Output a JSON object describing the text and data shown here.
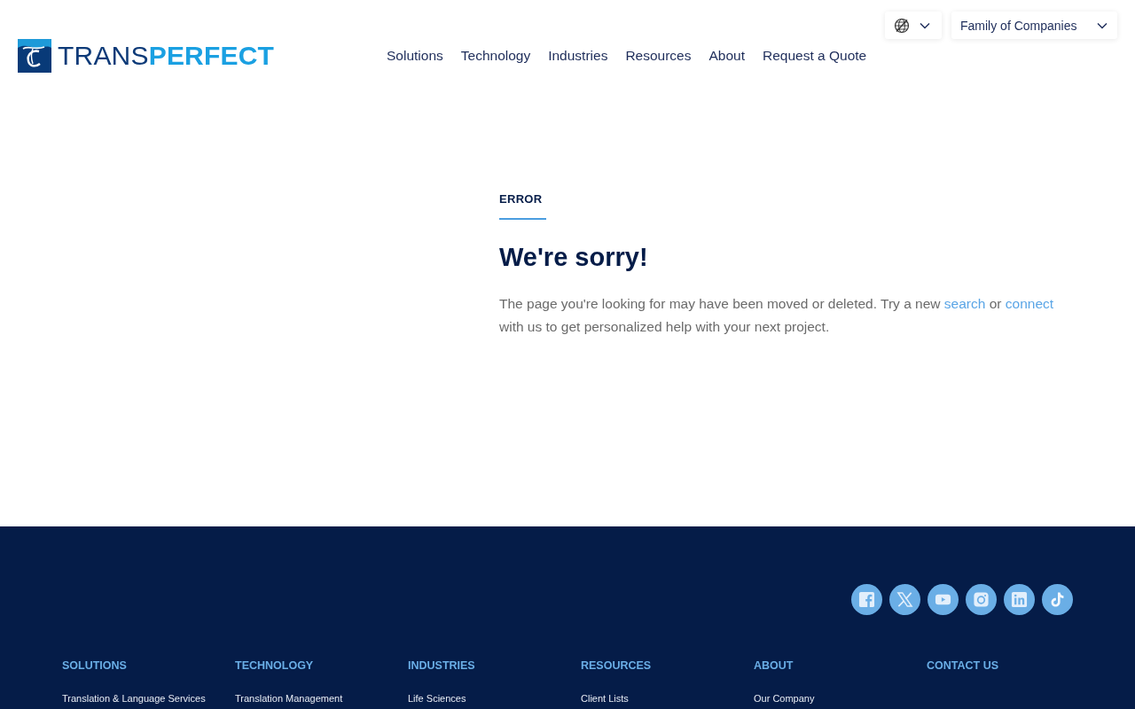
{
  "header": {
    "logo": {
      "parts": [
        {
          "text": "TRANS",
          "kind": "dark"
        },
        {
          "text": "PERFECT",
          "kind": "light"
        }
      ]
    },
    "company_selector": {
      "label": "Family of Companies"
    },
    "nav": [
      "Solutions",
      "Technology",
      "Industries",
      "Resources",
      "About",
      "Request a Quote"
    ]
  },
  "error": {
    "eyebrow": "ERROR",
    "title": "We're sorry!",
    "message": [
      {
        "kind": "text",
        "text": "The page you're looking for may have been moved or deleted. Try a new"
      },
      {
        "kind": "link",
        "text": "search"
      },
      {
        "kind": "text",
        "text": "or"
      },
      {
        "kind": "link",
        "text": "connect"
      },
      {
        "kind": "text",
        "text": "with us to get personalized help with your next project."
      }
    ]
  },
  "footer": {
    "social_links": [
      {
        "kind": "facebook"
      },
      {
        "kind": "x"
      },
      {
        "kind": "youtube"
      },
      {
        "kind": "instagram"
      },
      {
        "kind": "linkedin"
      },
      {
        "kind": "tiktok"
      }
    ],
    "columns": [
      {
        "heading": "SOLUTIONS",
        "links": [
          "Translation & Language Services"
        ]
      },
      {
        "heading": "TECHNOLOGY",
        "links": [
          "Translation Management"
        ]
      },
      {
        "heading": "INDUSTRIES",
        "links": [
          "Life Sciences"
        ]
      },
      {
        "heading": "RESOURCES",
        "links": [
          "Client Lists"
        ]
      },
      {
        "heading": "ABOUT",
        "links": [
          "Our Company"
        ]
      },
      {
        "heading": "CONTACT US"
      }
    ]
  }
}
